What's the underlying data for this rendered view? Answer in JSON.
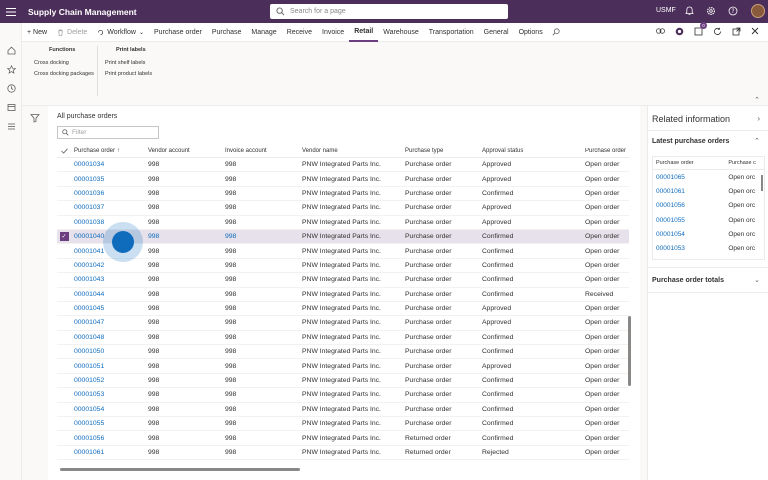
{
  "app": {
    "title": "Supply Chain Management",
    "company": "USMF"
  },
  "search": {
    "placeholder": "Search for a page"
  },
  "topbar": {
    "notifications_icon": "bell-icon",
    "settings_icon": "gear-icon",
    "help_icon": "question-icon"
  },
  "commands": {
    "new": "+ New",
    "delete": "Delete",
    "workflow": "Workflow",
    "tabs": [
      "Purchase order",
      "Purchase",
      "Manage",
      "Receive",
      "Invoice",
      "Retail",
      "Warehouse",
      "Transportation",
      "General",
      "Options"
    ],
    "active_tab": "Retail",
    "badge_count": "0"
  },
  "ribbon": {
    "groups": [
      {
        "title": "Functions",
        "items": [
          "Cross docking",
          "Cross docking packages"
        ]
      },
      {
        "title": "Print labels",
        "items": [
          "Print shelf labels",
          "Print product labels"
        ]
      }
    ]
  },
  "list": {
    "title": "All purchase orders",
    "filter_placeholder": "Filter",
    "columns": [
      "Purchase order",
      "Vendor account",
      "Invoice account",
      "Vendor name",
      "Purchase type",
      "Approval status",
      "Purchase order"
    ],
    "sort_indicator": "↑",
    "rows": [
      [
        "00001034",
        "998",
        "998",
        "PNW Integrated Parts Inc.",
        "Purchase order",
        "Approved",
        "Open order"
      ],
      [
        "00001035",
        "998",
        "998",
        "PNW Integrated Parts Inc.",
        "Purchase order",
        "Approved",
        "Open order"
      ],
      [
        "00001036",
        "998",
        "998",
        "PNW Integrated Parts Inc.",
        "Purchase order",
        "Confirmed",
        "Open order"
      ],
      [
        "00001037",
        "998",
        "998",
        "PNW Integrated Parts Inc.",
        "Purchase order",
        "Approved",
        "Open order"
      ],
      [
        "00001038",
        "998",
        "998",
        "PNW Integrated Parts Inc.",
        "Purchase order",
        "Approved",
        "Open order"
      ],
      [
        "00001040",
        "998",
        "998",
        "PNW Integrated Parts Inc.",
        "Purchase order",
        "Confirmed",
        "Open order"
      ],
      [
        "00001041",
        "998",
        "998",
        "PNW Integrated Parts Inc.",
        "Purchase order",
        "Confirmed",
        "Open order"
      ],
      [
        "00001042",
        "998",
        "998",
        "PNW Integrated Parts Inc.",
        "Purchase order",
        "Confirmed",
        "Open order"
      ],
      [
        "00001043",
        "998",
        "998",
        "PNW Integrated Parts Inc.",
        "Purchase order",
        "Confirmed",
        "Open order"
      ],
      [
        "00001044",
        "998",
        "998",
        "PNW Integrated Parts Inc.",
        "Purchase order",
        "Confirmed",
        "Received"
      ],
      [
        "00001045",
        "998",
        "998",
        "PNW Integrated Parts Inc.",
        "Purchase order",
        "Approved",
        "Open order"
      ],
      [
        "00001047",
        "998",
        "998",
        "PNW Integrated Parts Inc.",
        "Purchase order",
        "Approved",
        "Open order"
      ],
      [
        "00001048",
        "998",
        "998",
        "PNW Integrated Parts Inc.",
        "Purchase order",
        "Confirmed",
        "Open order"
      ],
      [
        "00001050",
        "998",
        "998",
        "PNW Integrated Parts Inc.",
        "Purchase order",
        "Confirmed",
        "Open order"
      ],
      [
        "00001051",
        "998",
        "998",
        "PNW Integrated Parts Inc.",
        "Purchase order",
        "Approved",
        "Open order"
      ],
      [
        "00001052",
        "998",
        "998",
        "PNW Integrated Parts Inc.",
        "Purchase order",
        "Confirmed",
        "Open order"
      ],
      [
        "00001053",
        "998",
        "998",
        "PNW Integrated Parts Inc.",
        "Purchase order",
        "Confirmed",
        "Open order"
      ],
      [
        "00001054",
        "998",
        "998",
        "PNW Integrated Parts Inc.",
        "Purchase order",
        "Confirmed",
        "Open order"
      ],
      [
        "00001055",
        "998",
        "998",
        "PNW Integrated Parts Inc.",
        "Purchase order",
        "Confirmed",
        "Open order"
      ],
      [
        "00001056",
        "998",
        "998",
        "PNW Integrated Parts Inc.",
        "Returned order",
        "Confirmed",
        "Open order"
      ],
      [
        "00001061",
        "998",
        "998",
        "PNW Integrated Parts Inc.",
        "Returned order",
        "Rejected",
        "Open order"
      ]
    ],
    "selected_row": 5
  },
  "related": {
    "title": "Related information",
    "latest_title": "Latest purchase orders",
    "latest_columns": [
      "Purchase order",
      "Purchase c"
    ],
    "latest_rows": [
      [
        "00001065",
        "Open orc"
      ],
      [
        "00001061",
        "Open orc"
      ],
      [
        "00001056",
        "Open orc"
      ],
      [
        "00001055",
        "Open orc"
      ],
      [
        "00001054",
        "Open orc"
      ],
      [
        "00001053",
        "Open orc"
      ]
    ],
    "totals_title": "Purchase order totals"
  },
  "colors": {
    "brand": "#4b2e59",
    "accent": "#6b3f7f",
    "link": "#0f6cbd",
    "selected_row": "#e6e1ea"
  }
}
